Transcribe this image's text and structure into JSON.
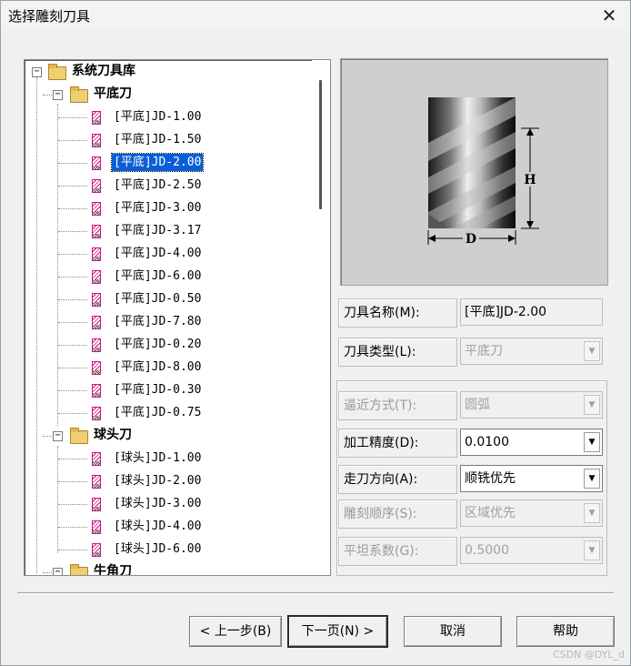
{
  "window": {
    "title": "选择雕刻刀具",
    "close_glyph": "✕"
  },
  "tree": {
    "root": {
      "label": "系统刀具库",
      "toggle": "−"
    },
    "groups": [
      {
        "label": "平底刀",
        "toggle": "−"
      },
      {
        "label": "球头刀",
        "toggle": "−"
      },
      {
        "label": "牛角刀",
        "toggle": "−"
      }
    ],
    "flat_items": [
      "[平底]JD-1.00",
      "[平底]JD-1.50",
      "[平底]JD-2.00",
      "[平底]JD-2.50",
      "[平底]JD-3.00",
      "[平底]JD-3.17",
      "[平底]JD-4.00",
      "[平底]JD-6.00",
      "[平底]JD-0.50",
      "[平底]JD-7.80",
      "[平底]JD-0.20",
      "[平底]JD-8.00",
      "[平底]JD-0.30",
      "[平底]JD-0.75"
    ],
    "ball_items": [
      "[球头]JD-1.00",
      "[球头]JD-2.00",
      "[球头]JD-3.00",
      "[球头]JD-4.00",
      "[球头]JD-6.00"
    ],
    "selected": "[平底]JD-2.00"
  },
  "preview": {
    "h_label": "H",
    "d_label": "D"
  },
  "fields": {
    "tool_name": {
      "label": "刀具名称(M):",
      "value": "[平底]JD-2.00"
    },
    "tool_type": {
      "label": "刀具类型(L):",
      "value": "平底刀"
    },
    "approach": {
      "label": "逼近方式(T):",
      "value": "圆弧"
    },
    "precision": {
      "label": "加工精度(D):",
      "value": "0.0100"
    },
    "direction": {
      "label": "走刀方向(A):",
      "value": "顺铣优先"
    },
    "order": {
      "label": "雕刻顺序(S):",
      "value": "区域优先"
    },
    "flatness": {
      "label": "平坦系数(G):",
      "value": "0.5000"
    }
  },
  "buttons": {
    "prev": "< 上一步(B)",
    "next": "下一页(N) >",
    "cancel": "取消",
    "help": "帮助"
  },
  "watermark": "CSDN @DYL_d",
  "colors": {
    "selection": "#0a5fd8",
    "tool_icon": "#d01080",
    "folder": "#f0cf70"
  }
}
